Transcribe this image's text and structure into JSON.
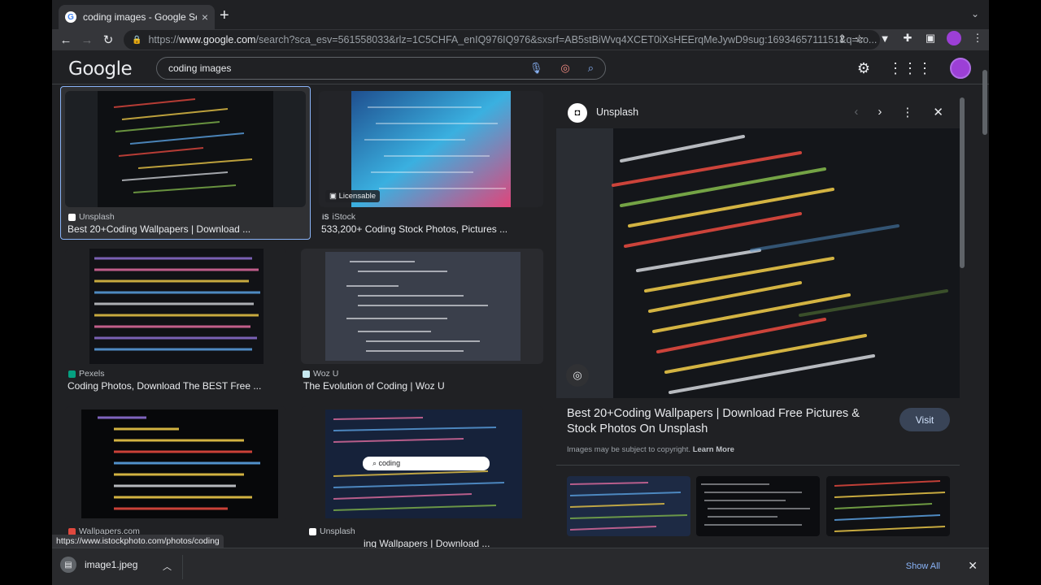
{
  "browser": {
    "tab_title": "coding images - Google Search",
    "tab_favicon": "G",
    "new_tab": "+",
    "url_prefix": "https://",
    "url_host": "www.google.com",
    "url_rest": "/search?sca_esv=561558033&rlz=1C5CHFA_enIQ976IQ976&sxsrf=AB5stBiWvq4XCET0iXsHEErqMeJywD9sug:1693465711151&q=co..."
  },
  "google": {
    "logo": "Google",
    "query": "coding images"
  },
  "results": [
    {
      "source": "Unsplash",
      "title": "Best 20+Coding Wallpapers | Download ...",
      "badge": ""
    },
    {
      "source": "iStock",
      "title": "533,200+ Coding Stock Photos, Pictures ...",
      "badge": "Licensable"
    },
    {
      "source": "Pexels",
      "title": "Coding Photos, Download The BEST Free ...",
      "badge": ""
    },
    {
      "source": "Woz U",
      "title": "The Evolution of Coding | Woz U",
      "badge": ""
    },
    {
      "source": "Wallpapers.com",
      "title": "",
      "badge": ""
    },
    {
      "source": "Unsplash",
      "title": "ing Wallpapers | Download ...",
      "badge": "coding"
    }
  ],
  "preview": {
    "source": "Unsplash",
    "title": "Best 20+Coding Wallpapers | Download Free Pictures & Stock Photos On Unsplash",
    "visit": "Visit",
    "copyright": "Images may be subject to copyright.",
    "learn_more": "Learn More"
  },
  "status_url": "https://www.istockphoto.com/photos/coding",
  "downloads": {
    "file": "image1.jpeg",
    "show_all": "Show All"
  },
  "colors": {
    "bg": "#202124",
    "accent": "#8ab4f8",
    "avatar": "#9c3fd6"
  }
}
